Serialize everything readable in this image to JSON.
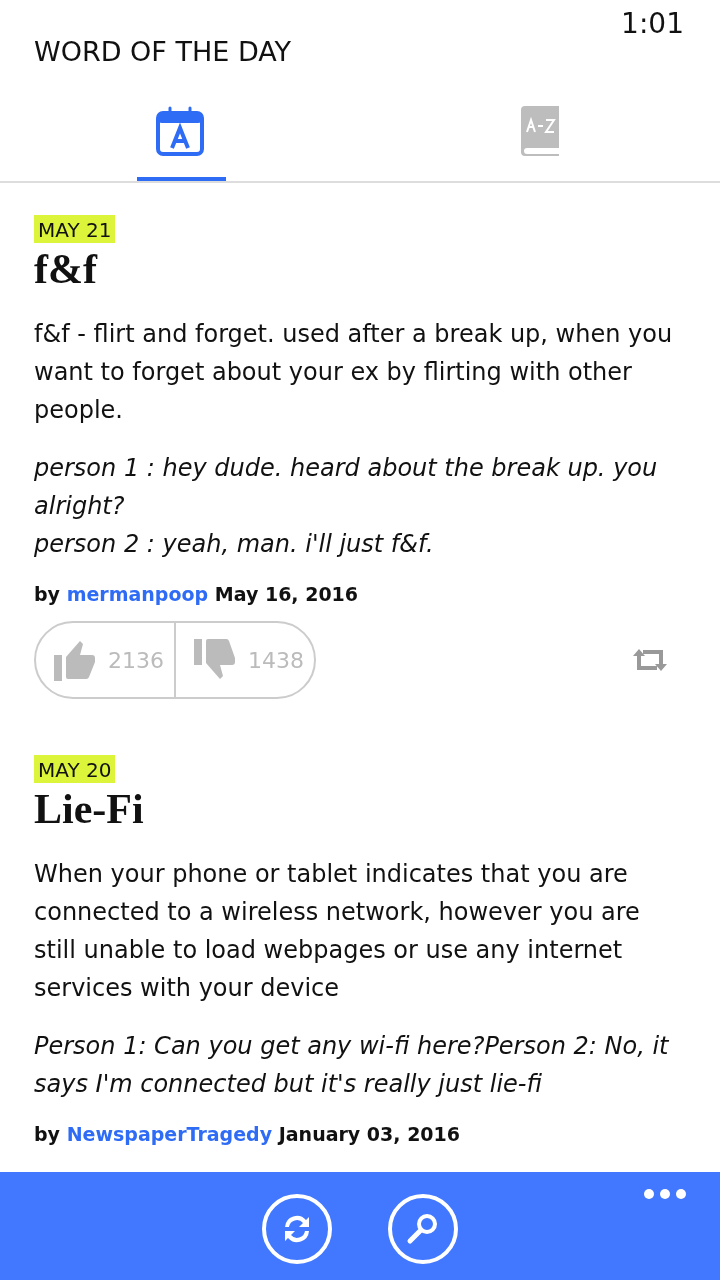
{
  "status_bar": {
    "time": "1:01"
  },
  "title": "WORD OF THE DAY",
  "tabs": [
    {
      "kind": "calendar",
      "selected": true
    },
    {
      "kind": "dictionary",
      "selected": false
    }
  ],
  "entries": [
    {
      "date": "MAY 21",
      "word": "f&f",
      "definition": "f&f - flirt and forget. used after a break up, when you want to forget about your ex by flirting with other people.",
      "example": [
        "person 1 : hey dude. heard about the break up. you alright?",
        "person 2 : yeah, man. i'll just f&f."
      ],
      "by_label": "by",
      "author": "mermanpoop",
      "posted": "May 16, 2016",
      "up": "2136",
      "down": "1438"
    },
    {
      "date": "MAY 20",
      "word": "Lie-Fi",
      "definition": "When your phone or tablet indicates that you are connected to a wireless network, however you are still unable to load webpages or use any internet services with your device",
      "example": [
        "Person 1: Can you get any wi-fi here?Person 2: No, it says I'm connected but it's really just lie-fi"
      ],
      "by_label": "by",
      "author": "NewspaperTragedy",
      "posted": "January 03, 2016"
    }
  ],
  "app_bar": {
    "buttons": [
      {
        "kind": "refresh"
      },
      {
        "kind": "search"
      }
    ]
  }
}
